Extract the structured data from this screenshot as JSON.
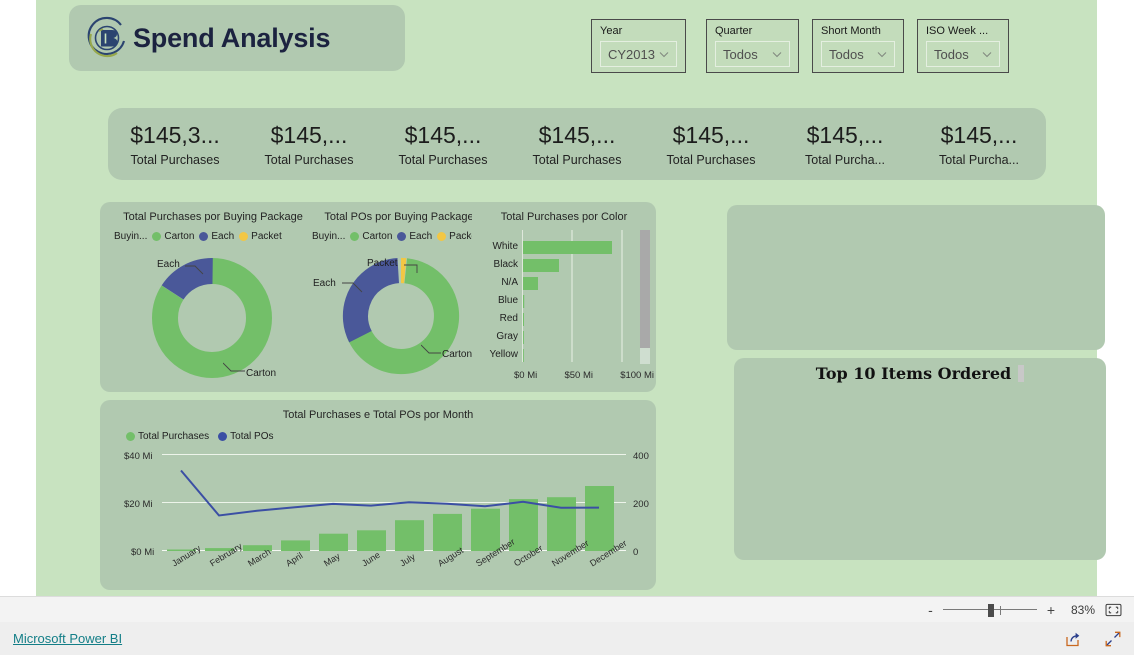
{
  "report": {
    "title": "Spend Analysis",
    "logo_icon": "company-b-logo-icon"
  },
  "slicers": [
    {
      "label": "Year",
      "value": "CY2013",
      "icon": "chevron-down-icon"
    },
    {
      "label": "Quarter",
      "value": "Todos",
      "icon": "chevron-down-icon"
    },
    {
      "label": "Short Month",
      "value": "Todos",
      "icon": "chevron-down-icon"
    },
    {
      "label": "ISO Week ...",
      "value": "Todos",
      "icon": "chevron-down-icon"
    }
  ],
  "kpi_cards": [
    {
      "value": "$145,3...",
      "label": "Total Purchases"
    },
    {
      "value": "$145,...",
      "label": "Total Purchases"
    },
    {
      "value": "$145,...",
      "label": "Total Purchases"
    },
    {
      "value": "$145,...",
      "label": "Total Purchases"
    },
    {
      "value": "$145,...",
      "label": "Total Purchases"
    },
    {
      "value": "$145,...",
      "label": "Total Purcha..."
    },
    {
      "value": "$145,...",
      "label": "Total Purcha..."
    }
  ],
  "placeholders": {
    "top_panel_title": "",
    "bottom_panel_title": "Top 10 Items Ordered"
  },
  "statusbar": {
    "zoom_minus": "-",
    "zoom_plus": "+",
    "zoom_level": "83%",
    "fit_icon": "fit-to-page-icon"
  },
  "footer": {
    "link": "Microsoft Power BI",
    "share_icon": "share-export-icon",
    "fullscreen_icon": "fullscreen-expand-icon"
  },
  "colors": {
    "canvas": "#c8e3c0",
    "panel": "#b1c9b0",
    "green": "#73bf69",
    "blue": "#4a5899",
    "yellow": "#f2c744",
    "link": "#137e87"
  },
  "chart_data": [
    {
      "type": "pie",
      "name": "purchases-by-buying-package",
      "title": "Total Purchases por Buying Package",
      "legend_title": "Buyin...",
      "legend_position": "top",
      "labels": [
        "Carton",
        "Each",
        "Packet"
      ],
      "values": [
        84,
        16,
        0.3
      ],
      "unit": "percent",
      "colors": [
        "#73bf69",
        "#4a5899",
        "#f2c744"
      ],
      "callouts": [
        "Each",
        "Carton"
      ]
    },
    {
      "type": "pie",
      "name": "pos-by-buying-package",
      "title": "Total POs por Buying Package",
      "legend_title": "Buyin...",
      "legend_position": "top",
      "labels": [
        "Carton",
        "Each",
        "Packet"
      ],
      "values": [
        67,
        31.5,
        1.5
      ],
      "unit": "percent",
      "colors": [
        "#73bf69",
        "#4a5899",
        "#f2c744"
      ],
      "callouts": [
        "Packet",
        "Each",
        "Carton"
      ]
    },
    {
      "type": "bar",
      "orientation": "horizontal",
      "name": "purchases-by-color",
      "title": "Total Purchases por Color",
      "categories": [
        "White",
        "Black",
        "N/A",
        "Blue",
        "Red",
        "Gray",
        "Yellow"
      ],
      "values": [
        89,
        36,
        15,
        0.4,
        0.3,
        0.2,
        0.1
      ],
      "xlabel": "",
      "ylabel": "",
      "xticks": [
        "$0 Mi",
        "$50 Mi",
        "$100 Mi"
      ],
      "xlim": [
        0,
        115
      ],
      "grid": true,
      "color": "#73bf69",
      "has_scrollbar": true
    },
    {
      "type": "line",
      "name": "purchases-and-pos-by-month",
      "title": "Total Purchases e Total POs por Month",
      "categories": [
        "January",
        "February",
        "March",
        "April",
        "May",
        "June",
        "July",
        "August",
        "September",
        "October",
        "November",
        "December"
      ],
      "series": [
        {
          "name": "Total Purchases",
          "type": "bar",
          "axis": "left",
          "values": [
            0.6,
            1.2,
            2.4,
            4.4,
            7.2,
            8.6,
            12.8,
            15.4,
            17.6,
            21.6,
            22.4,
            27.0
          ],
          "color": "#73bf69"
        },
        {
          "name": "Total POs",
          "type": "line",
          "axis": "right",
          "values": [
            335,
            148,
            168,
            182,
            196,
            189,
            203,
            197,
            186,
            205,
            180,
            181
          ],
          "color": "#3b4fa4"
        }
      ],
      "left_ticks": [
        "$0 Mi",
        "$20 Mi",
        "$40 Mi"
      ],
      "left_lim": [
        0,
        40
      ],
      "right_ticks": [
        "0",
        "200",
        "400"
      ],
      "right_lim": [
        0,
        400
      ],
      "legend": [
        "Total Purchases",
        "Total POs"
      ],
      "legend_position": "top-left",
      "grid": true
    }
  ]
}
